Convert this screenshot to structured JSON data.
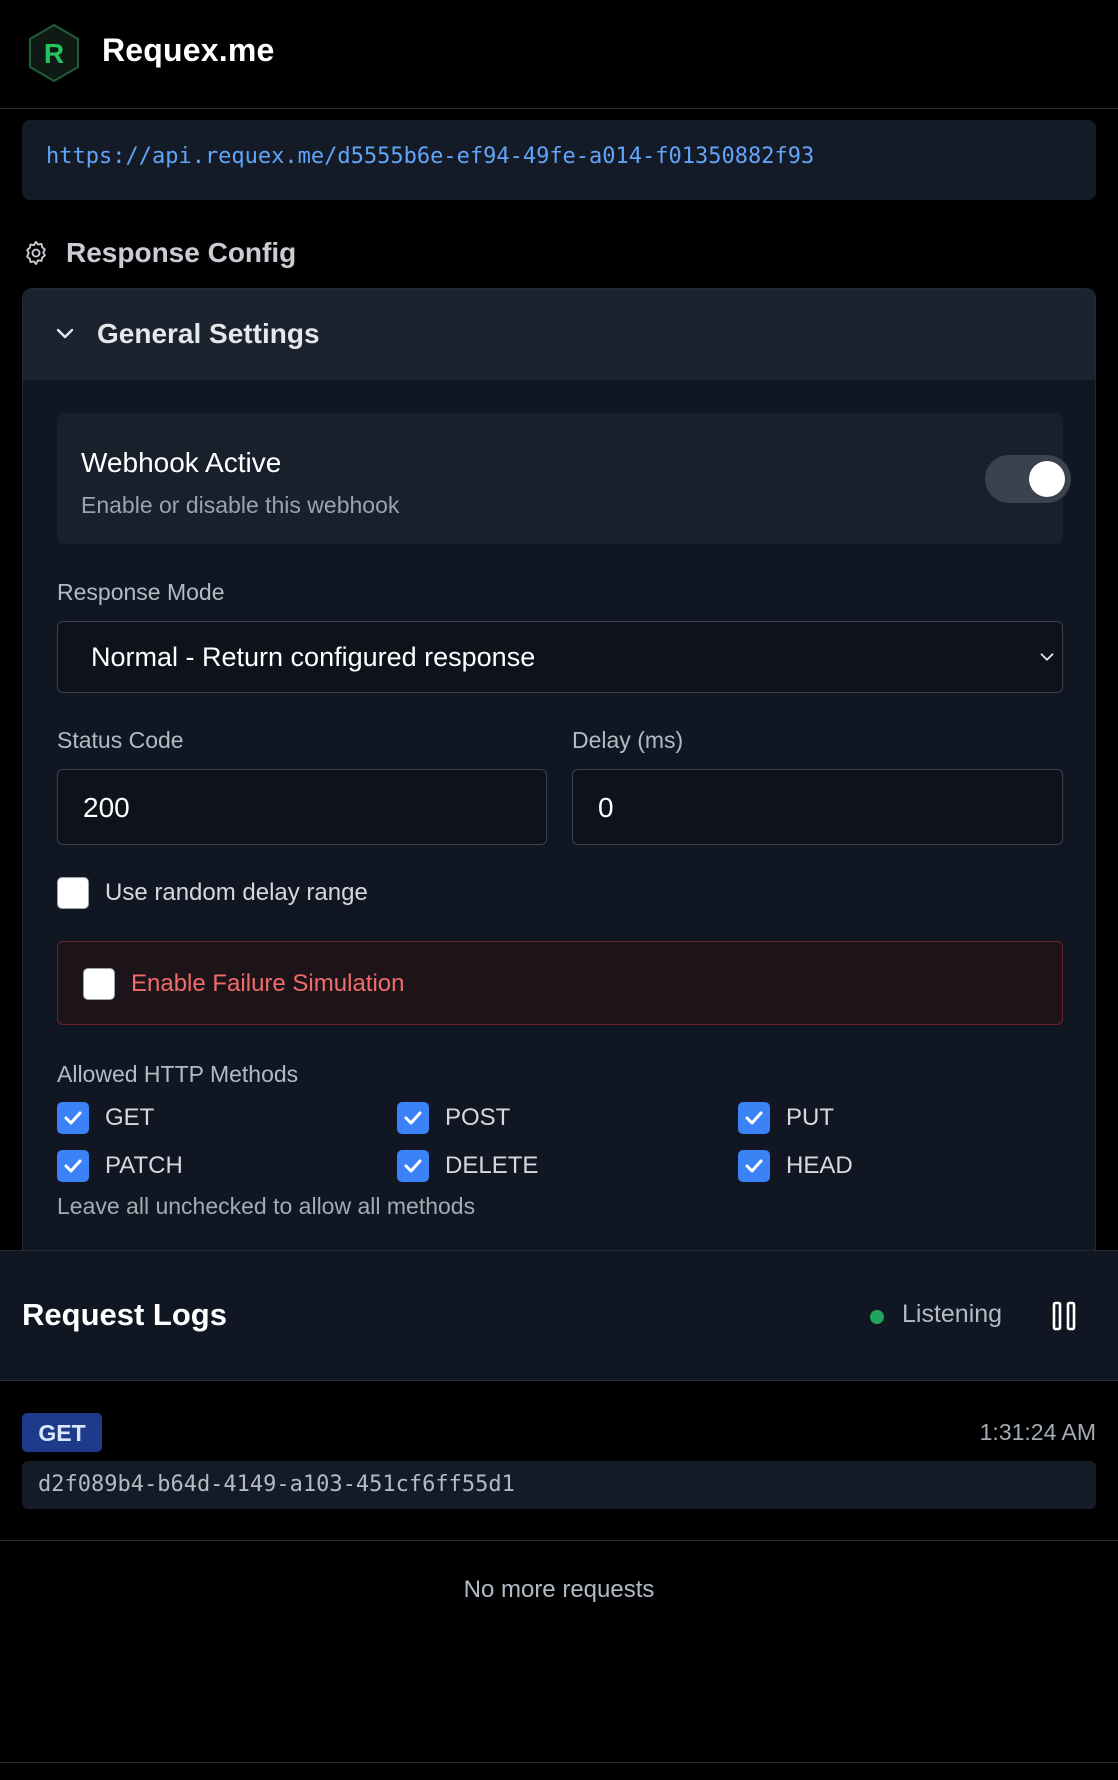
{
  "app": {
    "name": "Requex.me",
    "logo_letter": "R",
    "accent_color": "#22c55e"
  },
  "endpoint": {
    "url": "https://api.requex.me/d5555b6e-ef94-49fe-a014-f01350882f93"
  },
  "response_config": {
    "title": "Response Config",
    "icon": "gear-icon",
    "general_settings": {
      "title": "General Settings",
      "expanded": true,
      "webhook_active": {
        "title": "Webhook Active",
        "description": "Enable or disable this webhook",
        "enabled": true
      },
      "response_mode": {
        "label": "Response Mode",
        "selected": "Normal - Return configured response"
      },
      "status_code": {
        "label": "Status Code",
        "value": "200"
      },
      "delay": {
        "label": "Delay (ms)",
        "value": "0"
      },
      "random_delay": {
        "label": "Use random delay range",
        "checked": false
      },
      "failure_simulation": {
        "label": "Enable Failure Simulation",
        "checked": false,
        "color": "#f26b6b"
      },
      "allowed_methods": {
        "label": "Allowed HTTP Methods",
        "methods": [
          {
            "name": "GET",
            "checked": true
          },
          {
            "name": "POST",
            "checked": true
          },
          {
            "name": "PUT",
            "checked": true
          },
          {
            "name": "PATCH",
            "checked": true
          },
          {
            "name": "DELETE",
            "checked": true
          },
          {
            "name": "HEAD",
            "checked": true
          }
        ],
        "hint": "Leave all unchecked to allow all methods"
      }
    }
  },
  "request_logs": {
    "title": "Request Logs",
    "status": "Listening",
    "status_color": "#22a55a",
    "pause_icon": "pause-icon",
    "requests": [
      {
        "method": "GET",
        "time": "1:31:24 AM",
        "id": "d2f089b4-b64d-4149-a103-451cf6ff55d1"
      }
    ],
    "end_text": "No more requests"
  }
}
